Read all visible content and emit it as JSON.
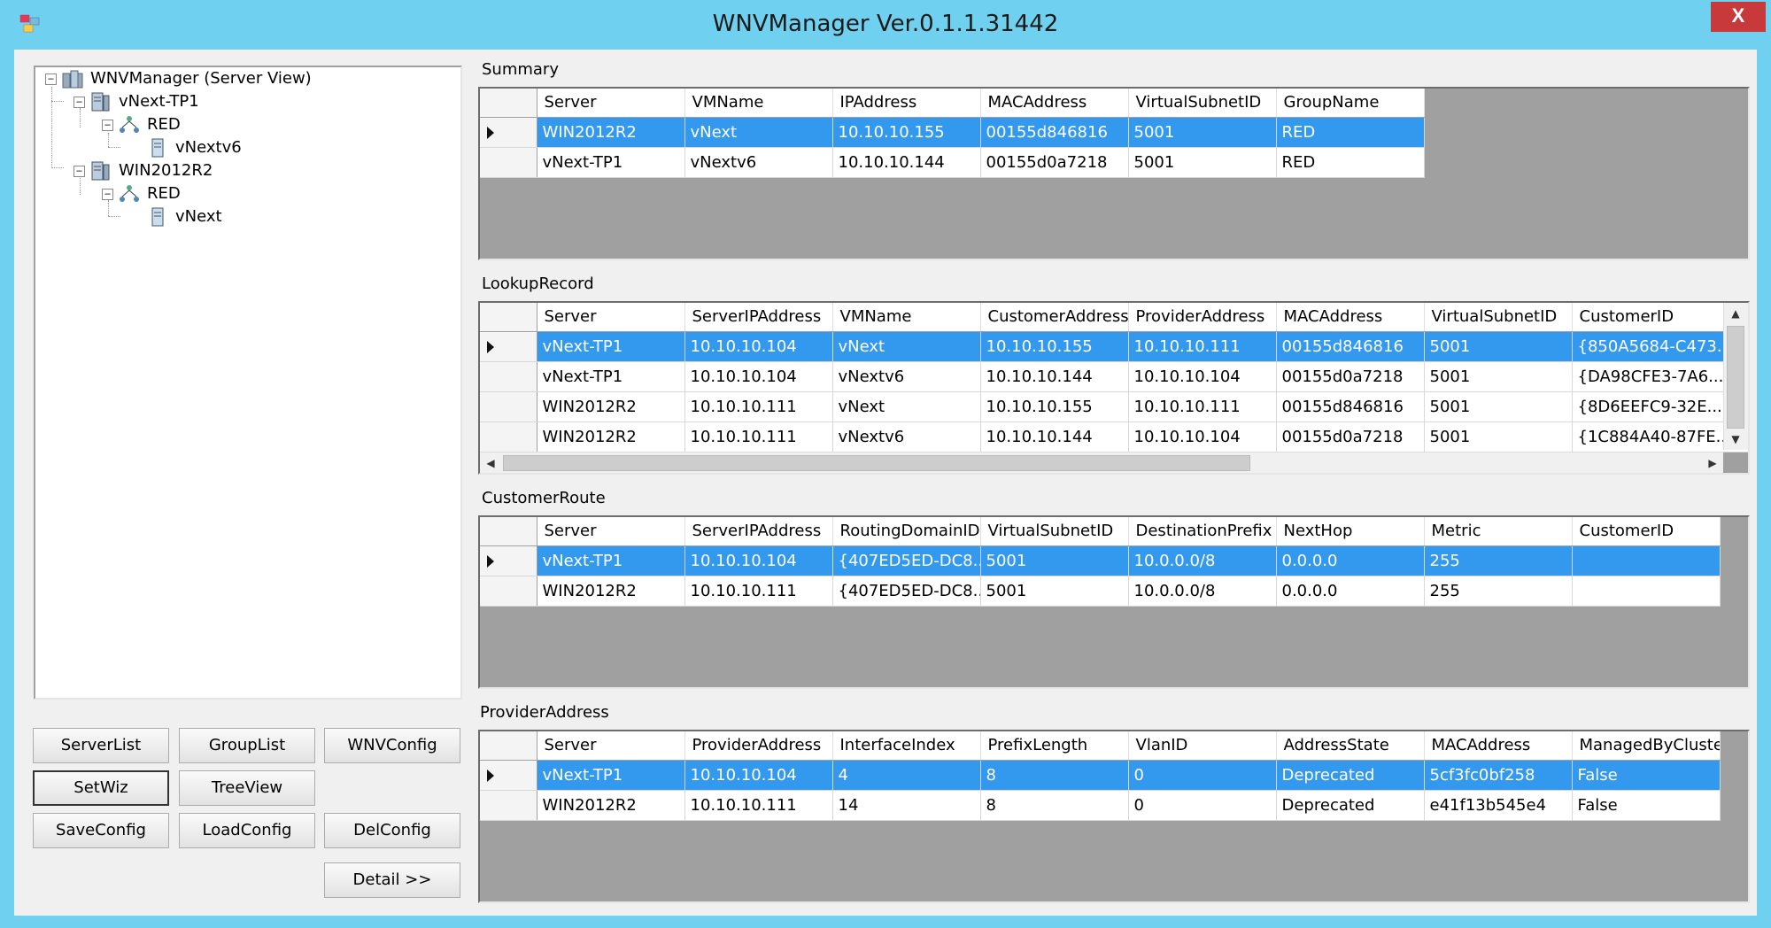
{
  "window": {
    "title": "WNVManager Ver.0.1.1.31442",
    "close_label": "X"
  },
  "tree": {
    "root": "WNVManager (Server View)",
    "server1": "vNext-TP1",
    "server1_group": "RED",
    "server1_vm": "vNextv6",
    "server2": "WIN2012R2",
    "server2_group": "RED",
    "server2_vm": "vNext"
  },
  "buttons": {
    "serverlist": "ServerList",
    "grouplist": "GroupList",
    "wnvconfig": "WNVConfig",
    "setwiz": "SetWiz",
    "treeview": "TreeView",
    "saveconfig": "SaveConfig",
    "loadconfig": "LoadConfig",
    "delconfig": "DelConfig",
    "detail": "Detail >>"
  },
  "summary": {
    "label": "Summary",
    "columns": [
      "Server",
      "VMName",
      "IPAddress",
      "MACAddress",
      "VirtualSubnetID",
      "GroupName"
    ],
    "rows": [
      [
        "WIN2012R2",
        "vNext",
        "10.10.10.155",
        "00155d846816",
        "5001",
        "RED"
      ],
      [
        "vNext-TP1",
        "vNextv6",
        "10.10.10.144",
        "00155d0a7218",
        "5001",
        "RED"
      ]
    ]
  },
  "lookup": {
    "label": "LookupRecord",
    "columns": [
      "Server",
      "ServerIPAddress",
      "VMName",
      "CustomerAddress",
      "ProviderAddress",
      "MACAddress",
      "VirtualSubnetID",
      "CustomerID"
    ],
    "rows": [
      [
        "vNext-TP1",
        "10.10.10.104",
        "vNext",
        "10.10.10.155",
        "10.10.10.111",
        "00155d846816",
        "5001",
        "{850A5684-C473..."
      ],
      [
        "vNext-TP1",
        "10.10.10.104",
        "vNextv6",
        "10.10.10.144",
        "10.10.10.104",
        "00155d0a7218",
        "5001",
        "{DA98CFE3-7A6..."
      ],
      [
        "WIN2012R2",
        "10.10.10.111",
        "vNext",
        "10.10.10.155",
        "10.10.10.111",
        "00155d846816",
        "5001",
        "{8D6EEFC9-32E..."
      ],
      [
        "WIN2012R2",
        "10.10.10.111",
        "vNextv6",
        "10.10.10.144",
        "10.10.10.104",
        "00155d0a7218",
        "5001",
        "{1C884A40-87FE..."
      ]
    ]
  },
  "route": {
    "label": "CustomerRoute",
    "columns": [
      "Server",
      "ServerIPAddress",
      "RoutingDomainID",
      "VirtualSubnetID",
      "DestinationPrefix",
      "NextHop",
      "Metric",
      "CustomerID"
    ],
    "rows": [
      [
        "vNext-TP1",
        "10.10.10.104",
        "{407ED5ED-DC8...",
        "5001",
        "10.0.0.0/8",
        "0.0.0.0",
        "255",
        ""
      ],
      [
        "WIN2012R2",
        "10.10.10.111",
        "{407ED5ED-DC8...",
        "5001",
        "10.0.0.0/8",
        "0.0.0.0",
        "255",
        ""
      ]
    ]
  },
  "provider": {
    "label": "ProviderAddress",
    "columns": [
      "Server",
      "ProviderAddress",
      "InterfaceIndex",
      "PrefixLength",
      "VlanID",
      "AddressState",
      "MACAddress",
      "ManagedByCluste"
    ],
    "rows": [
      [
        "vNext-TP1",
        "10.10.10.104",
        "4",
        "8",
        "0",
        "Deprecated",
        "5cf3fc0bf258",
        "False"
      ],
      [
        "WIN2012R2",
        "10.10.10.111",
        "14",
        "8",
        "0",
        "Deprecated",
        "e41f13b545e4",
        "False"
      ]
    ]
  },
  "colors": {
    "title_bg": "#6fd0f0",
    "selection": "#3399ee",
    "close_bg": "#c7393b"
  },
  "icons": {
    "app": "app-icon",
    "server": "server-icon",
    "network": "network-icon",
    "vm": "vm-icon"
  }
}
